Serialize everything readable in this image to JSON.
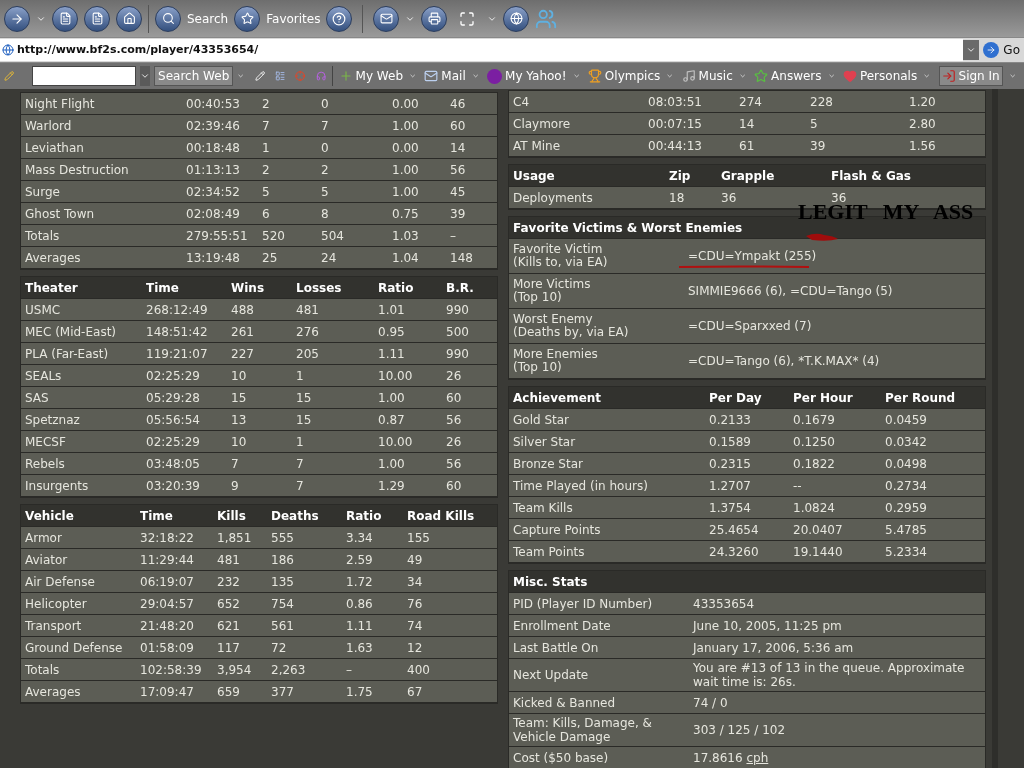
{
  "browser": {
    "toolbar": [
      "Search",
      "Favorites"
    ],
    "address": "http://www.bf2s.com/player/43353654/",
    "go": "Go",
    "yahoo_toolbar": {
      "search_button": "Search Web",
      "items": [
        {
          "label": "My Web",
          "kind": "menu"
        },
        {
          "label": "Mail",
          "kind": "menu"
        },
        {
          "label": "My Yahoo!",
          "kind": "menu"
        },
        {
          "label": "Olympics",
          "kind": "menu"
        },
        {
          "label": "Music",
          "kind": "menu"
        },
        {
          "label": "Answers",
          "kind": "menu"
        },
        {
          "label": "Personals",
          "kind": "menu"
        },
        {
          "label": "Sign In",
          "kind": "button"
        }
      ]
    }
  },
  "maps_table": {
    "rows": [
      [
        "Night Flight",
        "00:40:53",
        "2",
        "0",
        "0.00",
        "46"
      ],
      [
        "Warlord",
        "02:39:46",
        "7",
        "7",
        "1.00",
        "60"
      ],
      [
        "Leviathan",
        "00:18:48",
        "1",
        "0",
        "0.00",
        "14"
      ],
      [
        "Mass Destruction",
        "01:13:13",
        "2",
        "2",
        "1.00",
        "56"
      ],
      [
        "Surge",
        "02:34:52",
        "5",
        "5",
        "1.00",
        "45"
      ],
      [
        "Ghost Town",
        "02:08:49",
        "6",
        "8",
        "0.75",
        "39"
      ],
      [
        "Totals",
        "279:55:51",
        "520",
        "504",
        "1.03",
        "–"
      ],
      [
        "Averages",
        "13:19:48",
        "25",
        "24",
        "1.04",
        "148"
      ]
    ]
  },
  "theater_table": {
    "columns": [
      "Theater",
      "Time",
      "Wins",
      "Losses",
      "Ratio",
      "B.R."
    ],
    "rows": [
      [
        "USMC",
        "268:12:49",
        "488",
        "481",
        "1.01",
        "990"
      ],
      [
        "MEC (Mid-East)",
        "148:51:42",
        "261",
        "276",
        "0.95",
        "500"
      ],
      [
        "PLA (Far-East)",
        "119:21:07",
        "227",
        "205",
        "1.11",
        "990"
      ],
      [
        "SEALs",
        "02:25:29",
        "10",
        "1",
        "10.00",
        "26"
      ],
      [
        "SAS",
        "05:29:28",
        "15",
        "15",
        "1.00",
        "60"
      ],
      [
        "Spetznaz",
        "05:56:54",
        "13",
        "15",
        "0.87",
        "56"
      ],
      [
        "MECSF",
        "02:25:29",
        "10",
        "1",
        "10.00",
        "26"
      ],
      [
        "Rebels",
        "03:48:05",
        "7",
        "7",
        "1.00",
        "56"
      ],
      [
        "Insurgents",
        "03:20:39",
        "9",
        "7",
        "1.29",
        "60"
      ]
    ]
  },
  "vehicle_table": {
    "columns": [
      "Vehicle",
      "Time",
      "Kills",
      "Deaths",
      "Ratio",
      "Road Kills"
    ],
    "rows": [
      [
        "Armor",
        "32:18:22",
        "1,851",
        "555",
        "3.34",
        "155"
      ],
      [
        "Aviator",
        "11:29:44",
        "481",
        "186",
        "2.59",
        "49"
      ],
      [
        "Air Defense",
        "06:19:07",
        "232",
        "135",
        "1.72",
        "34"
      ],
      [
        "Helicopter",
        "29:04:57",
        "652",
        "754",
        "0.86",
        "76"
      ],
      [
        "Transport",
        "21:48:20",
        "621",
        "561",
        "1.11",
        "74"
      ],
      [
        "Ground Defense",
        "01:58:09",
        "117",
        "72",
        "1.63",
        "12"
      ],
      [
        "Totals",
        "102:58:39",
        "3,954",
        "2,263",
        "–",
        "400"
      ],
      [
        "Averages",
        "17:09:47",
        "659",
        "377",
        "1.75",
        "67"
      ]
    ]
  },
  "kits_table": {
    "rows": [
      [
        "C4",
        "08:03:51",
        "274",
        "228",
        "1.20"
      ],
      [
        "Claymore",
        "00:07:15",
        "14",
        "5",
        "2.80"
      ],
      [
        "AT Mine",
        "00:44:13",
        "61",
        "39",
        "1.56"
      ]
    ]
  },
  "usage_table": {
    "columns": [
      "Usage",
      "Zip",
      "Grapple",
      "Flash & Gas"
    ],
    "rows": [
      [
        "Deployments",
        "18",
        "36",
        "36"
      ]
    ]
  },
  "victims": {
    "title": "Favorite Victims & Worst Enemies",
    "rows": [
      {
        "label_lines": [
          "Favorite Victim",
          "(Kills to, via EA)"
        ],
        "value": "=CDU=Ympakt (255)"
      },
      {
        "label_lines": [
          "More Victims",
          "(Top 10)"
        ],
        "value": "SIMMIE9666 (6), =CDU=Tango (5)"
      },
      {
        "label_lines": [
          "Worst Enemy",
          "(Deaths by, via EA)"
        ],
        "value": "=CDU=Sparxxed (7)"
      },
      {
        "label_lines": [
          "More Enemies",
          "(Top 10)"
        ],
        "value": "=CDU=Tango (6), *T.K.MAX* (4)"
      }
    ]
  },
  "achievement_table": {
    "columns": [
      "Achievement",
      "Per Day",
      "Per Hour",
      "Per Round"
    ],
    "rows": [
      [
        "Gold Star",
        "0.2133",
        "0.1679",
        "0.0459"
      ],
      [
        "Silver Star",
        "0.1589",
        "0.1250",
        "0.0342"
      ],
      [
        "Bronze Star",
        "0.2315",
        "0.1822",
        "0.0498"
      ],
      [
        "Time Played (in hours)",
        "1.2707",
        "--",
        "0.2734"
      ],
      [
        "Team Kills",
        "1.3754",
        "1.0824",
        "0.2959"
      ],
      [
        "Capture Points",
        "25.4654",
        "20.0407",
        "5.4785"
      ],
      [
        "Team Points",
        "24.3260",
        "19.1440",
        "5.2334"
      ]
    ]
  },
  "misc": {
    "title": "Misc. Stats",
    "rows": [
      {
        "label": "PID (Player ID Number)",
        "value": "43353654"
      },
      {
        "label": "Enrollment Date",
        "value": "June 10, 2005, 11:25 pm"
      },
      {
        "label": "Last Battle On",
        "value": "January 17, 2006, 5:36 am"
      },
      {
        "label": "Next Update",
        "value": "You are #13 of 13 in the queue. Approximate wait time is: 26s."
      },
      {
        "label": "Kicked & Banned",
        "value": "74 / 0"
      },
      {
        "label": "Team: Kills, Damage, & Vehicle Damage",
        "value": "303 / 125 / 102"
      },
      {
        "label": "Cost ($50 base)",
        "value": "17.8616",
        "link": "cph"
      }
    ]
  },
  "annotation": {
    "text": "LEGIT MY ASS"
  }
}
